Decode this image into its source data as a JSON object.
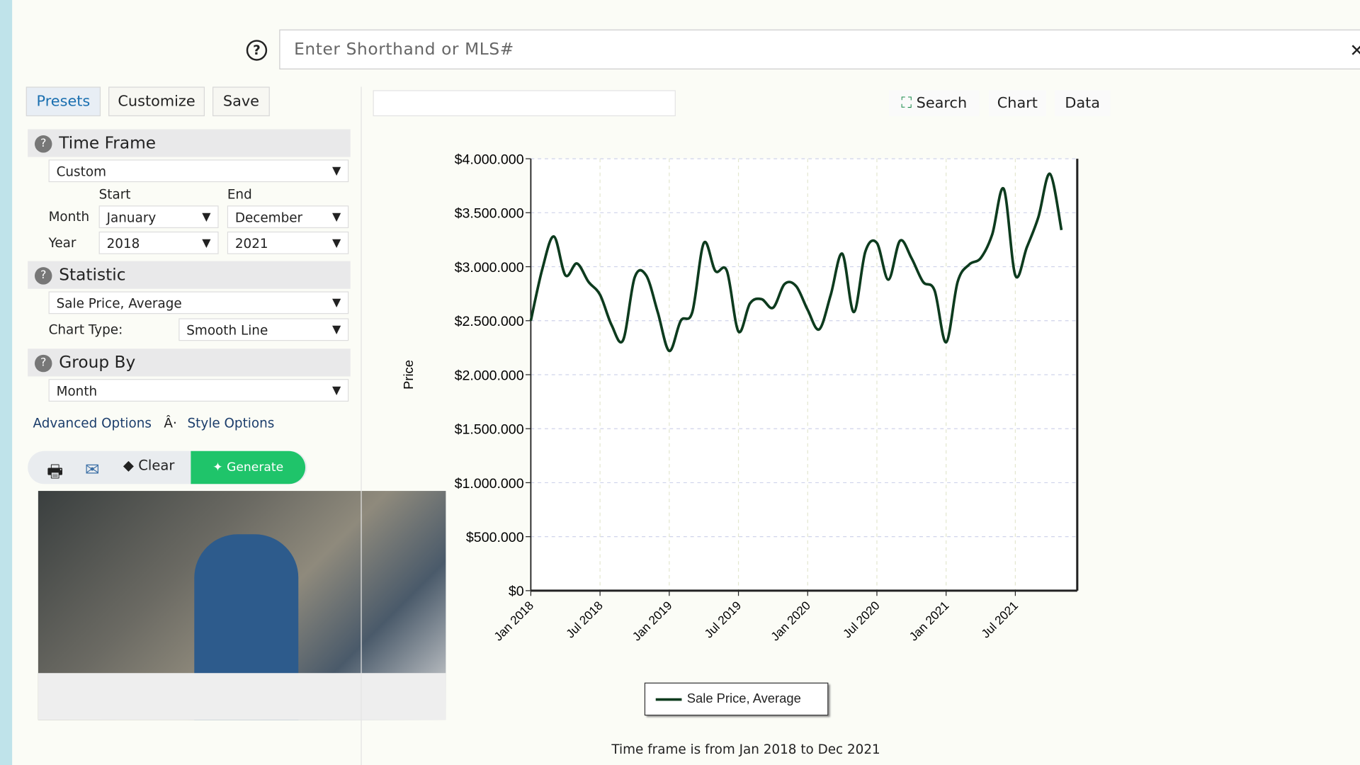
{
  "search": {
    "placeholder": "Enter Shorthand or MLS#",
    "help_icon": "question-circle-icon",
    "close_icon": "x-icon"
  },
  "tabs": [
    {
      "label": "Presets",
      "active": true
    },
    {
      "label": "Customize"
    },
    {
      "label": "Save"
    }
  ],
  "time_frame": {
    "title": "Time Frame",
    "preset": "Custom",
    "start_label": "Start",
    "end_label": "End",
    "month_label": "Month",
    "year_label": "Year",
    "start_month": "January",
    "end_month": "December",
    "start_year": "2018",
    "end_year": "2021"
  },
  "statistic": {
    "title": "Statistic",
    "value": "Sale Price, Average",
    "chart_type_label": "Chart Type:",
    "chart_type": "Smooth Line"
  },
  "group_by": {
    "title": "Group By",
    "value": "Month"
  },
  "links": {
    "advanced": "Advanced Options",
    "sep": "Â·",
    "style": "Style Options"
  },
  "actions": {
    "clear": "Clear",
    "generate": "Generate"
  },
  "chart_toolbar": {
    "search": "Search",
    "chart": "Chart",
    "data": "Data"
  },
  "footer": "Time frame is from Jan 2018 to Dec 2021",
  "colors": {
    "line": "#0d3b1e",
    "generate": "#1fc46a",
    "tab_active": "#1a6fb0"
  },
  "chart_data": {
    "type": "line",
    "ylabel": "Price",
    "ylim": [
      0,
      4000000
    ],
    "yticks": [
      "$0",
      "$500,000",
      "$1,000,000",
      "$1,500,000",
      "$2,000,000",
      "$2,500,000",
      "$3,000,000",
      "$3,500,000",
      "$4,000,000"
    ],
    "xticks": [
      "Jan 2018",
      "Jul 2018",
      "Jan 2019",
      "Jul 2019",
      "Jan 2020",
      "Jul 2020",
      "Jan 2021",
      "Jul 2021"
    ],
    "grid": true,
    "legend": "bottom",
    "series": [
      {
        "name": "Sale Price, Average",
        "start": "2018-01",
        "values": [
          2500000,
          2980000,
          3280000,
          2920000,
          3030000,
          2860000,
          2740000,
          2460000,
          2320000,
          2900000,
          2920000,
          2580000,
          2220000,
          2500000,
          2580000,
          3220000,
          2960000,
          2960000,
          2400000,
          2660000,
          2700000,
          2620000,
          2840000,
          2820000,
          2600000,
          2420000,
          2740000,
          3120000,
          2580000,
          3140000,
          3220000,
          2880000,
          3240000,
          3080000,
          2860000,
          2780000,
          2300000,
          2860000,
          3020000,
          3080000,
          3300000,
          3720000,
          2920000,
          3180000,
          3460000,
          3860000,
          3340000
        ]
      }
    ]
  }
}
